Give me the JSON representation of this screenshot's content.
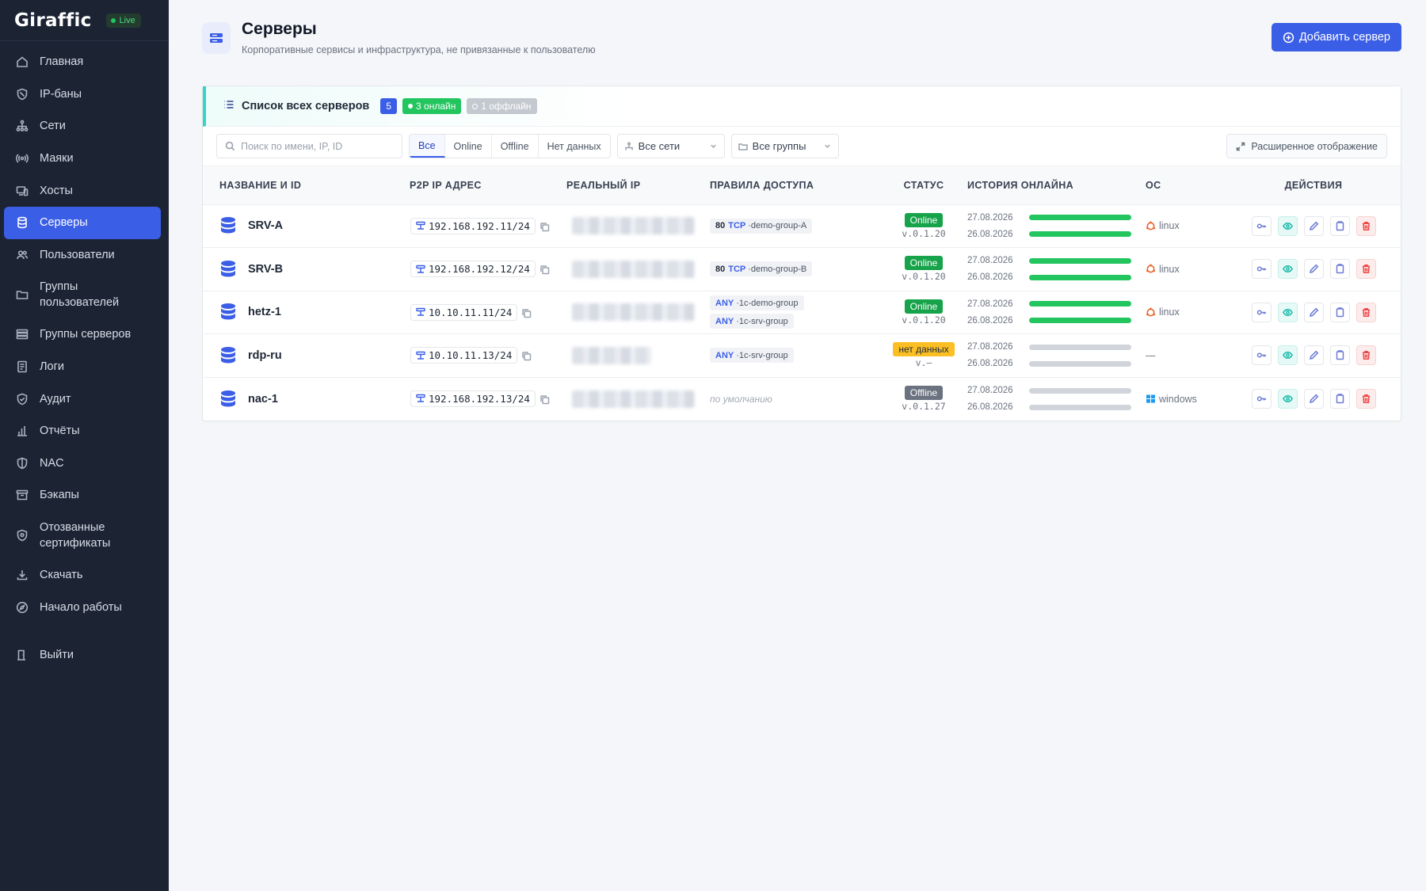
{
  "brand": {
    "name": "Giraffic",
    "live": "Live"
  },
  "sidebar": {
    "items": [
      {
        "label": "Главная",
        "icon": "home-icon"
      },
      {
        "label": "IP-баны",
        "icon": "shield-ban-icon"
      },
      {
        "label": "Сети",
        "icon": "network-icon"
      },
      {
        "label": "Маяки",
        "icon": "beacon-icon"
      },
      {
        "label": "Хосты",
        "icon": "hosts-icon"
      },
      {
        "label": "Серверы",
        "icon": "database-icon",
        "active": true
      },
      {
        "label": "Пользователи",
        "icon": "users-icon"
      },
      {
        "label": "Группы пользователей",
        "icon": "folder-icon"
      },
      {
        "label": "Группы серверов",
        "icon": "server-groups-icon"
      },
      {
        "label": "Логи",
        "icon": "log-icon"
      },
      {
        "label": "Аудит",
        "icon": "audit-shield-icon"
      },
      {
        "label": "Отчёты",
        "icon": "chart-icon"
      },
      {
        "label": "NAC",
        "icon": "nac-shield-icon"
      },
      {
        "label": "Бэкапы",
        "icon": "archive-icon"
      },
      {
        "label": "Отозванные сертификаты",
        "icon": "revoked-cert-icon"
      },
      {
        "label": "Скачать",
        "icon": "download-icon"
      },
      {
        "label": "Начало работы",
        "icon": "compass-icon"
      }
    ],
    "logout": "Выйти"
  },
  "header": {
    "title": "Серверы",
    "subtitle": "Корпоративные сервисы и инфраструктура, не привязанные к пользователю",
    "add_button": "Добавить сервер"
  },
  "card": {
    "title": "Список всех серверов",
    "count": "5",
    "online": "3 онлайн",
    "offline": "1 оффлайн"
  },
  "toolbar": {
    "search_placeholder": "Поиск по имени, IP, ID",
    "filters": [
      "Все",
      "Online",
      "Offline",
      "Нет данных"
    ],
    "active_filter": "Все",
    "networks": "Все сети",
    "groups": "Все группы",
    "expand": "Расширенное отображение"
  },
  "table": {
    "columns": [
      "НАЗВАНИЕ И ID",
      "P2P IP АДРЕС",
      "РЕАЛЬНЫЙ IP",
      "ПРАВИЛА ДОСТУПА",
      "СТАТУС",
      "ИСТОРИЯ ОНЛАЙНА",
      "ОС",
      "ДЕЙСТВИЯ"
    ],
    "rows": [
      {
        "name": "SRV-A",
        "p2p": "192.168.192.11/24",
        "rule_port": "80",
        "rule_proto": "TCP",
        "rule_group": "·demo-group-A",
        "status": "Online",
        "version": "v.0.1.20",
        "d1": "27.08.2026",
        "d2": "26.08.2026",
        "os": "linux"
      },
      {
        "name": "SRV-B",
        "p2p": "192.168.192.12/24",
        "rule_port": "80",
        "rule_proto": "TCP",
        "rule_group": "·demo-group-B",
        "status": "Online",
        "version": "v.0.1.20",
        "d1": "27.08.2026",
        "d2": "26.08.2026",
        "os": "linux"
      },
      {
        "name": "hetz-1",
        "p2p": "10.10.11.11/24",
        "rule1_any": "ANY",
        "rule1_group": "·1c-demo-group",
        "rule2_any": "ANY",
        "rule2_group": "·1c-srv-group",
        "status": "Online",
        "version": "v.0.1.20",
        "d1": "27.08.2026",
        "d2": "26.08.2026",
        "os": "linux"
      },
      {
        "name": "rdp-ru",
        "p2p": "10.10.11.13/24",
        "rule1_any": "ANY",
        "rule1_group": "·1c-srv-group",
        "status": "нет данных",
        "version": "v.–",
        "d1": "27.08.2026",
        "d2": "26.08.2026",
        "os": "—"
      },
      {
        "name": "nac-1",
        "p2p": "192.168.192.13/24",
        "rule_default": "по умолчанию",
        "status": "Offline",
        "version": "v.0.1.27",
        "d1": "27.08.2026",
        "d2": "26.08.2026",
        "os": "windows"
      }
    ]
  },
  "colors": {
    "sidebar_bg": "#1c2434",
    "accent": "#3b5ee6",
    "online": "#16a34a",
    "nodata": "#fbbf24",
    "offline": "#6b7280",
    "teal": "#38d3c7"
  }
}
